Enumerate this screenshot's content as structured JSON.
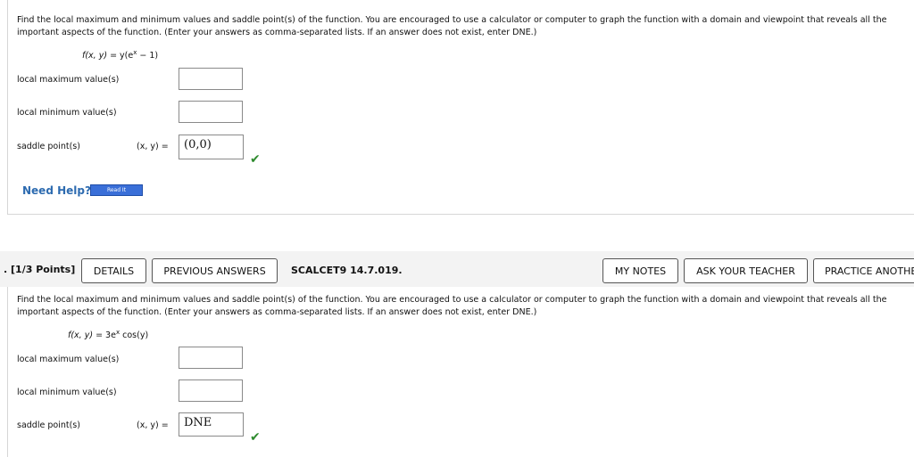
{
  "q1": {
    "prompt_line1": "Find the local maximum and minimum values and saddle point(s) of the function. You are encouraged to use a calculator or computer to graph the function with a domain and viewpoint that reveals all the",
    "prompt_line2": "important aspects of the function. (Enter your answers as comma-separated lists. If an answer does not exist, enter DNE.)",
    "function_lhs": "f(x, y)",
    "function_rhs": "= y(e",
    "function_exp": "x",
    "function_tail": " − 1)",
    "local_max_label": "local maximum value(s)",
    "local_max_value": "",
    "local_min_label": "local minimum value(s)",
    "local_min_value": "",
    "saddle_label": "saddle point(s)",
    "xy_label": "(x, y)  =",
    "saddle_value": "(0,0)",
    "check": "✔",
    "help_text": "Need Help?",
    "read_it": "Read It"
  },
  "q2": {
    "points": ". [1/3 Points]",
    "details_btn": "DETAILS",
    "prev_btn": "PREVIOUS ANSWERS",
    "code": "SCALCET9 14.7.019.",
    "notes_btn": "MY NOTES",
    "teacher_btn": "ASK YOUR TEACHER",
    "practice_btn": "PRACTICE ANOTHER",
    "prompt_line1": "Find the local maximum and minimum values and saddle point(s) of the function. You are encouraged to use a calculator or computer to graph the function with a domain and viewpoint that reveals all the",
    "prompt_line2": "important aspects of the function. (Enter your answers as comma-separated lists. If an answer does not exist, enter DNE.)",
    "function_lhs": "f(x, y)",
    "function_rhs": "= 3e",
    "function_exp": "x",
    "function_tail": " cos(y)",
    "local_max_label": "local maximum value(s)",
    "local_max_value": "",
    "local_min_label": "local minimum value(s)",
    "local_min_value": "",
    "saddle_label": "saddle point(s)",
    "xy_label": "(x, y)  =",
    "saddle_value": "DNE",
    "check": "✔"
  }
}
